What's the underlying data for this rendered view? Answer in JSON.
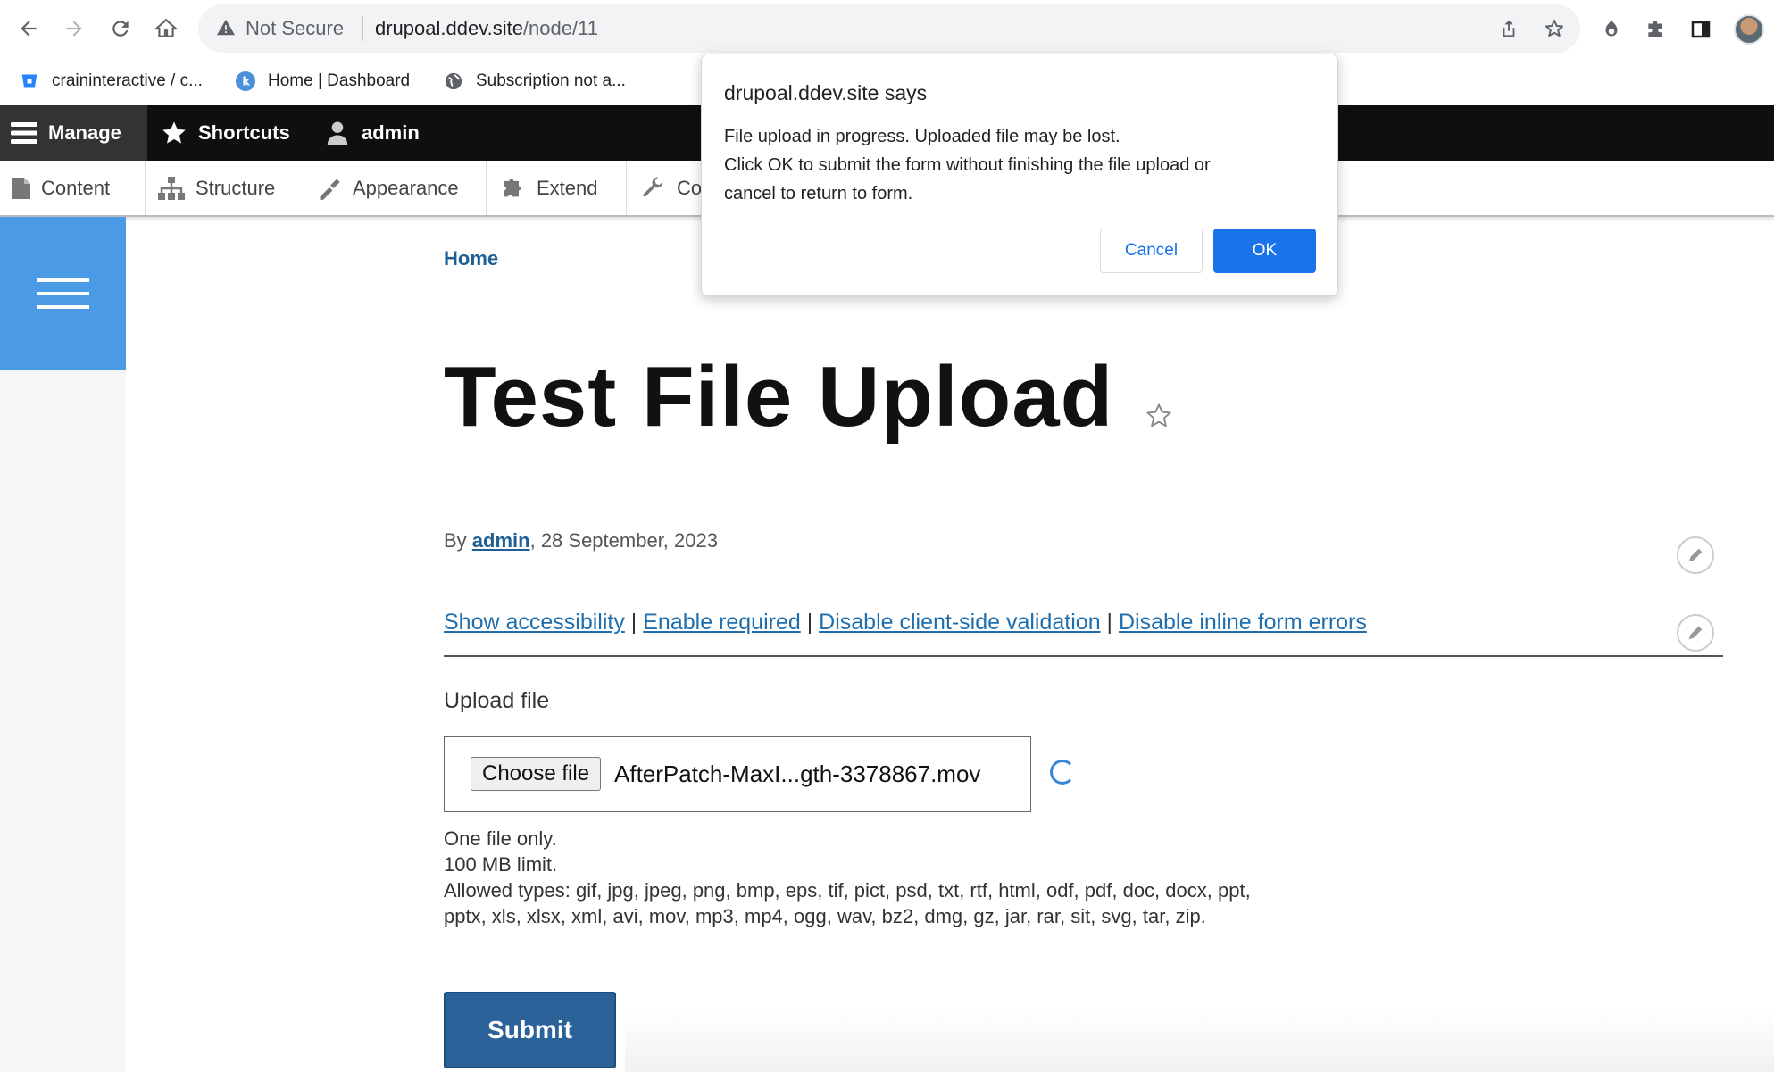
{
  "browser": {
    "security_label": "Not Secure",
    "url_host": "drupoal.ddev.site",
    "url_path": "/node/11",
    "bookmarks": [
      {
        "label": "craininteractive / c..."
      },
      {
        "label": "Home | Dashboard"
      },
      {
        "label": "Subscription not a..."
      }
    ]
  },
  "drupal_toolbar": {
    "manage": "Manage",
    "shortcuts": "Shortcuts",
    "user": "admin",
    "tray": [
      "Content",
      "Structure",
      "Appearance",
      "Extend",
      "Co"
    ]
  },
  "page": {
    "breadcrumb": "Home",
    "title": "Test File Upload",
    "by_prefix": "By ",
    "author": "admin",
    "date": ", 28 September, 2023",
    "links": [
      "Show accessibility",
      "Enable required",
      "Disable client-side validation",
      "Disable inline form errors"
    ],
    "link_separator": " | ",
    "upload_label": "Upload file",
    "choose_file": "Choose file",
    "file_name": "AfterPatch-MaxI...gth-3378867.mov",
    "help": [
      "One file only.",
      "100 MB limit.",
      "Allowed types: gif, jpg, jpeg, png, bmp, eps, tif, pict, psd, txt, rtf, html, odf, pdf, doc, docx, ppt, pptx, xls, xlsx, xml, avi, mov, mp3, mp4, ogg, wav, bz2, dmg, gz, jar, rar, sit, svg, tar, zip."
    ],
    "submit": "Submit"
  },
  "dialog": {
    "title": "drupoal.ddev.site says",
    "message_lines": [
      "File upload in progress. Uploaded file may be lost.",
      "Click OK to submit the form without finishing the file upload or",
      "cancel to return to form."
    ],
    "cancel": "Cancel",
    "ok": "OK"
  },
  "colors": {
    "drupal_blue": "#4a9ae6",
    "link_blue": "#1f6fae",
    "submit_blue": "#2a6299",
    "chrome_blue": "#1a73e8"
  }
}
